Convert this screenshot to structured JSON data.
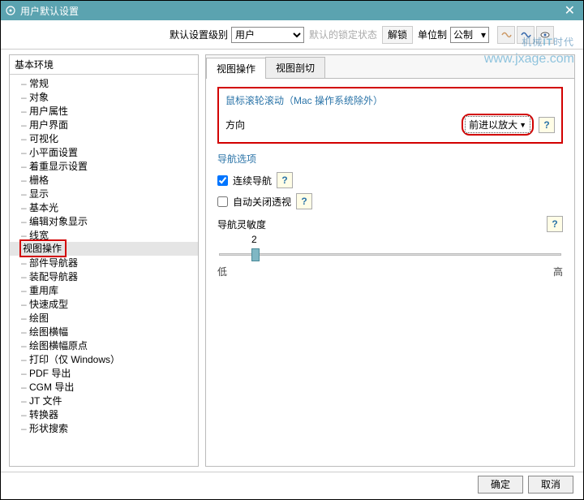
{
  "titlebar": {
    "title": "用户默认设置"
  },
  "toolbar": {
    "level_label": "默认设置级别",
    "level_value": "用户",
    "lock_label": "默认的锁定状态",
    "lock_button": "解锁",
    "unit_label": "单位制",
    "unit_value": "公制"
  },
  "sidebar": {
    "caption": "基本环境",
    "items": [
      "常规",
      "对象",
      "用户属性",
      "用户界面",
      "可视化",
      "小平面设置",
      "着重显示设置",
      "栅格",
      "显示",
      "基本光",
      "编辑对象显示",
      "线宽",
      "视图操作",
      "部件导航器",
      "装配导航器",
      "重用库",
      "快速成型",
      "绘图",
      "绘图横幅",
      "绘图横幅原点",
      "打印（仅 Windows）",
      "PDF 导出",
      "CGM 导出",
      "JT 文件",
      "转换器",
      "形状搜索"
    ],
    "selected_index": 12
  },
  "tabs": {
    "items": [
      "视图操作",
      "视图剖切"
    ],
    "active": 0
  },
  "content": {
    "scroll_title": "鼠标滚轮滚动（Mac 操作系统除外）",
    "direction_label": "方向",
    "direction_value": "前进以放大",
    "nav_title": "导航选项",
    "chk_continuous": "连续导航",
    "chk_continuous_checked": true,
    "chk_autoclose": "自动关闭透视",
    "chk_autoclose_checked": false,
    "sensitivity_label": "导航灵敏度",
    "sensitivity_value": "2",
    "low": "低",
    "high": "高",
    "help": "?"
  },
  "footer": {
    "ok": "确定",
    "cancel": "取消"
  },
  "watermark": {
    "line1a": "机械",
    "line1b": "时代",
    "line2": "www.jxage.com"
  }
}
